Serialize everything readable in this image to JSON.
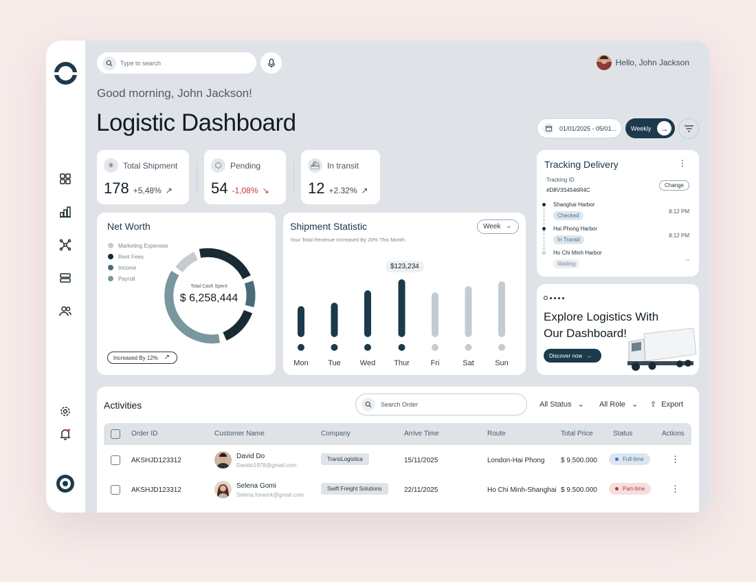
{
  "header": {
    "search_placeholder": "Type to search",
    "greeting_user": "Hello, John Jackson",
    "good_morning": "Good morning, John Jackson!",
    "title": "Logistic Dashboard",
    "date_range": "01/01/2025 - 05/01...",
    "period_label": "Weekly"
  },
  "stats": [
    {
      "label": "Total Shipment",
      "value": "178",
      "change": "+5,48%",
      "trend": "up"
    },
    {
      "label": "Pending",
      "value": "54",
      "change": "-1,08%",
      "trend": "down"
    },
    {
      "label": "In transit",
      "value": "12",
      "change": "+2.32%",
      "trend": "up"
    }
  ],
  "net_worth": {
    "title": "Net Worth",
    "legend": [
      {
        "label": "Marketing Expenses",
        "color": "#c4ccd2"
      },
      {
        "label": "Rent Fees",
        "color": "#1a2a33"
      },
      {
        "label": "Income",
        "color": "#4a6b78"
      },
      {
        "label": "Payroll",
        "color": "#7a979f"
      }
    ],
    "center_label": "Total Cash Spent",
    "center_value": "$ 6,258,444",
    "increased_label": "Increased By 12%"
  },
  "shipment": {
    "title": "Shipment Statistic",
    "subtitle": "Your Total Revenue Increased By 20% This Month.",
    "period": "Week",
    "tooltip": "$123,234"
  },
  "chart_data": {
    "type": "bar",
    "categories": [
      "Mon",
      "Tue",
      "Wed",
      "Thur",
      "Fri",
      "Sat",
      "Sun"
    ],
    "values": [
      45,
      50,
      68,
      84,
      65,
      74,
      81
    ],
    "highlighted": [
      true,
      true,
      true,
      true,
      false,
      false,
      false
    ],
    "colors": {
      "active": "#1b3a4b",
      "inactive": "#c2ccd2"
    }
  },
  "tracking": {
    "title": "Tracking Delivery",
    "id_label": "Tracking ID",
    "id_value": "#D8V3S4546R4C",
    "change_label": "Change",
    "stops": [
      {
        "name": "Shanghai Harbor",
        "status": "Checked",
        "time": "8:12 PM"
      },
      {
        "name": "Hai Phong Harbor",
        "status": "In Transit",
        "time": "8:12 PM"
      },
      {
        "name": "Ho Chi Minh Harbor",
        "status": "Waiting",
        "time": "--"
      }
    ]
  },
  "promo": {
    "title": "Explore Logistics With Our Dashboard!",
    "button": "Discover now"
  },
  "activities": {
    "title": "Activities",
    "search_placeholder": "Search Order",
    "status_filter": "All Status",
    "role_filter": "All Role",
    "export_label": "Export",
    "columns": [
      "Order ID",
      "Customer Name",
      "Company",
      "Arrive Time",
      "Route",
      "Total Price",
      "Status",
      "Actions"
    ],
    "rows": [
      {
        "order_id": "AKSHJD123312",
        "name": "David Do",
        "email": "Davido1978@gmail.com",
        "company": "TransLogistica",
        "arrive": "15/11/2025",
        "route": "London-Hai Phong",
        "price": "$ 9.500.000",
        "status": "Full-time"
      },
      {
        "order_id": "AKSHJD123312",
        "name": "Selena Gomi",
        "email": "Selena.forwork@gmail.com",
        "company": "Swift Freight Solutions",
        "arrive": "22/11/2025",
        "route": "Ho Chi Minh-Shanghai",
        "price": "$ 9.500.000",
        "status": "Part-time"
      }
    ]
  }
}
